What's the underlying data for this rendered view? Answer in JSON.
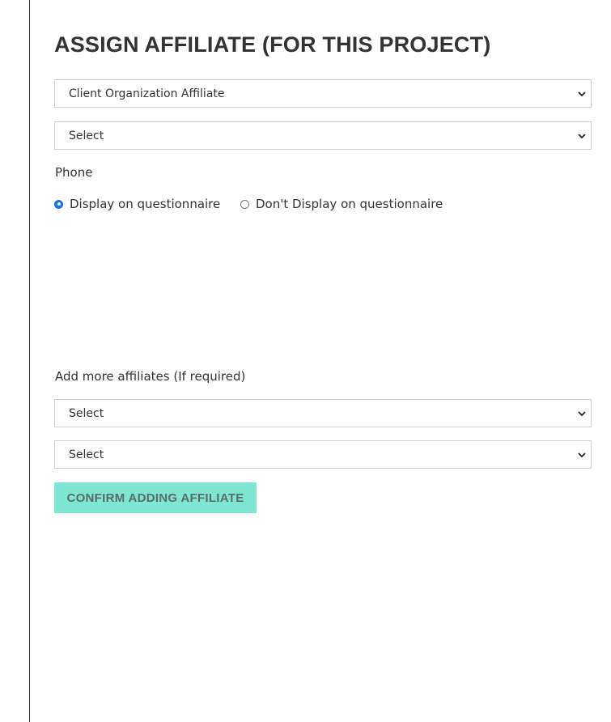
{
  "page": {
    "title": "ASSIGN AFFILIATE (FOR THIS PROJECT)"
  },
  "affiliate_type_select": {
    "value": "Client Organization Affiliate"
  },
  "affiliate_select": {
    "value": "Select"
  },
  "phone": {
    "label": "Phone",
    "options": [
      {
        "label": "Display on questionnaire",
        "checked": true
      },
      {
        "label": "Don't Display on questionnaire",
        "checked": false
      }
    ]
  },
  "more_affiliates": {
    "label": "Add more affiliates (If required)",
    "select_1_value": "Select",
    "select_2_value": "Select"
  },
  "confirm_button": {
    "label": "CONFIRM ADDING AFFILIATE"
  },
  "colors": {
    "button_bg": "#7ee6d2",
    "button_text": "#5b6b68",
    "radio_checked": "#1a73e8",
    "text": "#333333",
    "border": "#cfcfcf"
  },
  "icons": {
    "select_arrow": "chevron-down-icon"
  }
}
